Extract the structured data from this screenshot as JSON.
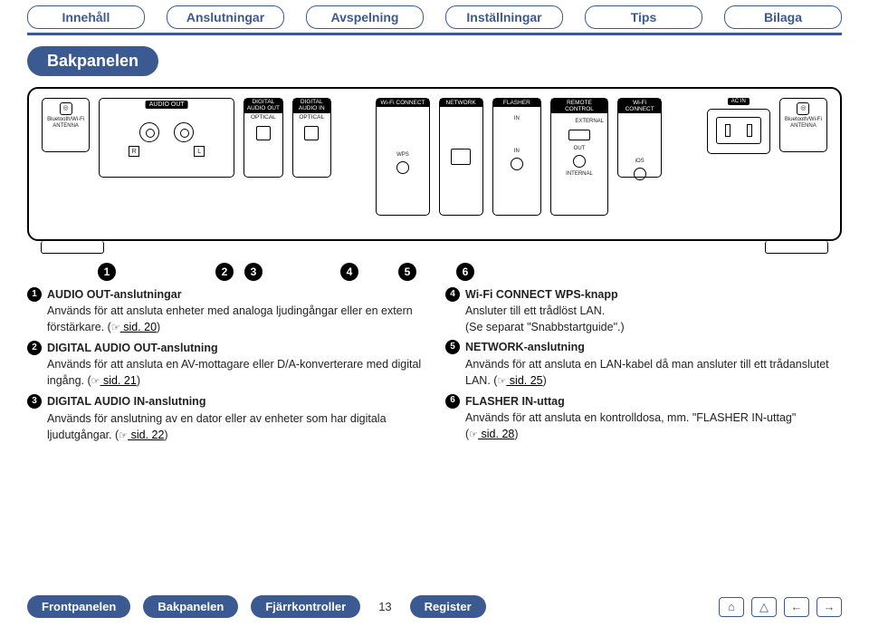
{
  "tabs": {
    "innehall": "Innehåll",
    "anslutningar": "Anslutningar",
    "avspelning": "Avspelning",
    "installningar": "Inställningar",
    "tips": "Tips",
    "bilaga": "Bilaga"
  },
  "page_title": "Bakpanelen",
  "panel": {
    "antenna": "Bluetooth/Wi-Fi ANTENNA",
    "audio_out": "AUDIO OUT",
    "r": "R",
    "l": "L",
    "dig_out_top": "DIGITAL AUDIO OUT",
    "dig_in_top": "DIGITAL AUDIO IN",
    "optical": "OPTICAL",
    "wifi_connect": "Wi-Fi CONNECT",
    "wps": "WPS",
    "ios": "iOS",
    "network": "NETWORK",
    "flasher": "FLASHER",
    "in": "IN",
    "out": "OUT",
    "remote": "REMOTE CONTROL",
    "external": "EXTERNAL",
    "internal": "INTERNAL",
    "ac_in": "AC IN"
  },
  "callouts": {
    "n1": "1",
    "n2": "2",
    "n3": "3",
    "n4": "4",
    "n5": "5",
    "n6": "6"
  },
  "left": {
    "i1": {
      "title": "AUDIO OUT-anslutningar",
      "body": "Används för att ansluta enheter med analoga ljudingångar eller en extern förstärkare. (",
      "ref": " sid. 20",
      "close": ")"
    },
    "i2": {
      "title": "DIGITAL AUDIO OUT-anslutning",
      "body": "Används för att ansluta en AV-mottagare eller D/A-konverterare med digital ingång. (",
      "ref": " sid. 21",
      "close": ")"
    },
    "i3": {
      "title": "DIGITAL AUDIO IN-anslutning",
      "body": "Används för anslutning av en dator eller av enheter som har digitala ljudutgångar. (",
      "ref": " sid. 22",
      "close": ")"
    }
  },
  "right": {
    "i4": {
      "title": "Wi-Fi CONNECT WPS-knapp",
      "body1": "Ansluter till ett trådlöst LAN.",
      "body2": "(Se separat \"Snabbstartguide\".)"
    },
    "i5": {
      "title": "NETWORK-anslutning",
      "body": "Används för att ansluta en LAN-kabel då man ansluter till ett trådanslutet LAN. (",
      "ref": " sid. 25",
      "close": ")"
    },
    "i6": {
      "title": "FLASHER IN-uttag",
      "body": "Används för att ansluta en kontrolldosa, mm. \"FLASHER IN-uttag\" (",
      "ref": " sid. 28",
      "close": ")"
    }
  },
  "hand_glyph": "☞",
  "footer": {
    "frontpanelen": "Frontpanelen",
    "bakpanelen": "Bakpanelen",
    "fjarrkontroller": "Fjärrkontroller",
    "register": "Register",
    "page": "13"
  },
  "icons": {
    "home": "⌂",
    "up": "△",
    "prev": "←",
    "next": "→"
  }
}
